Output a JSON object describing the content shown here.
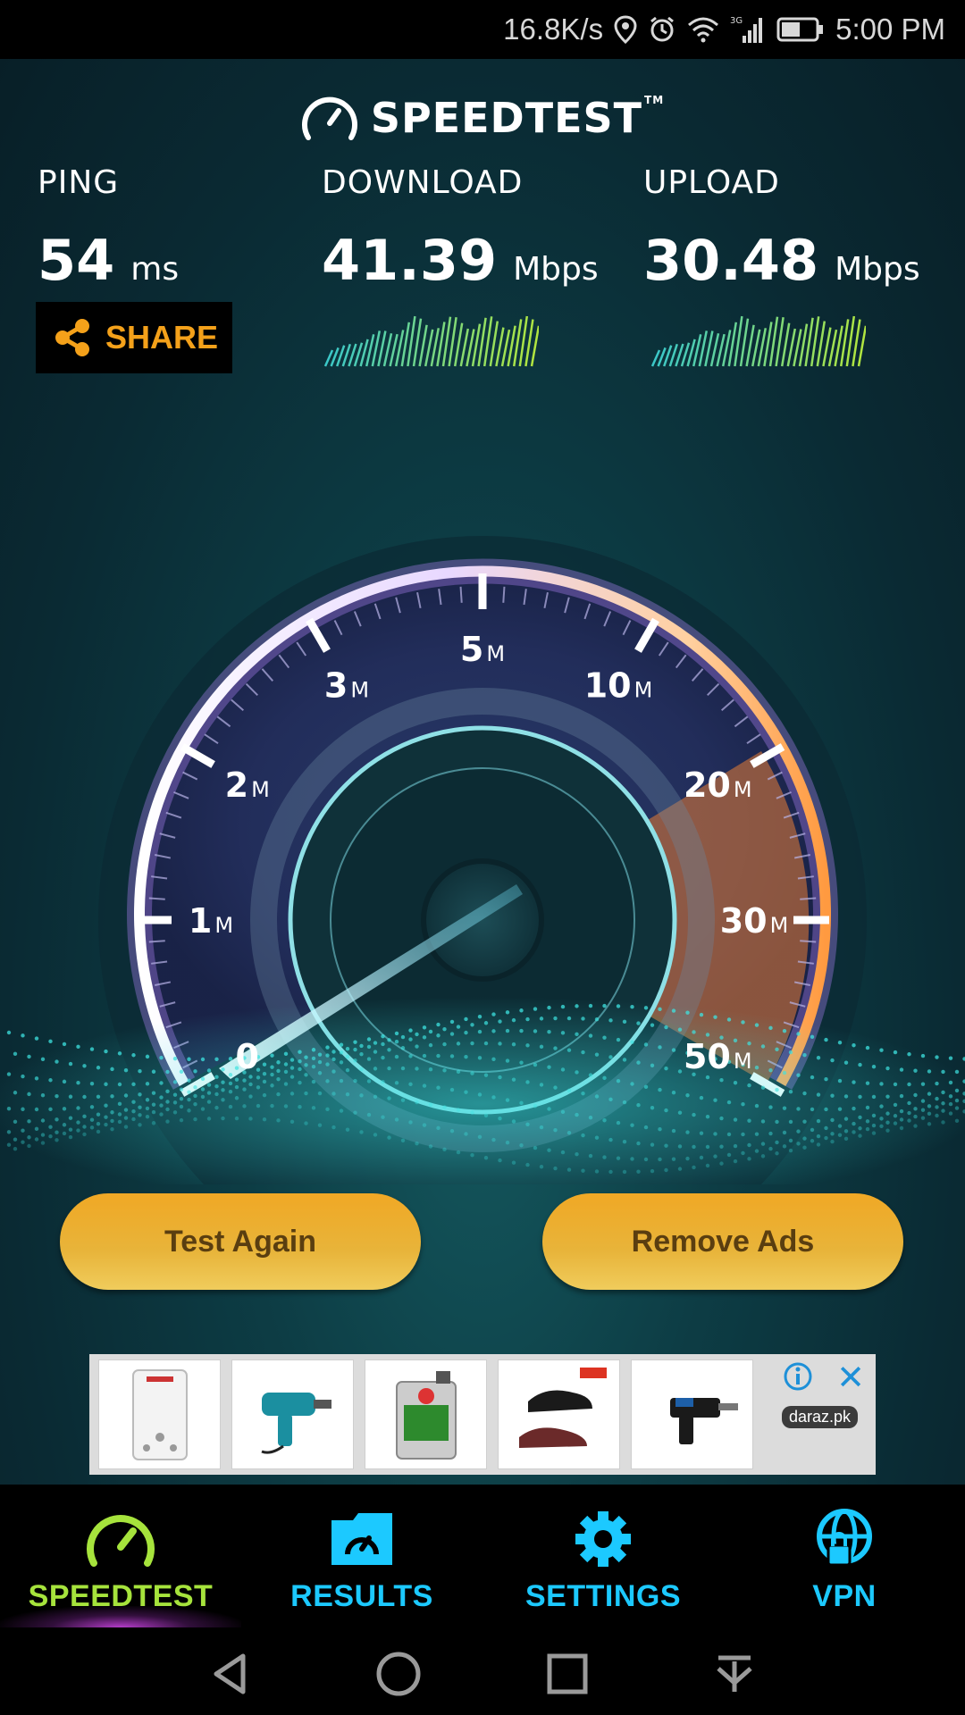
{
  "status_bar": {
    "speed": "16.8K/s",
    "network": "3G",
    "time": "5:00 PM",
    "icons": [
      "location-icon",
      "alarm-icon",
      "wifi-icon",
      "signal-icon",
      "battery-icon"
    ]
  },
  "header": {
    "logo_text": "SPEEDTEST",
    "trademark": "TM"
  },
  "metrics": {
    "ping": {
      "label": "PING",
      "value": "54",
      "unit": "ms"
    },
    "download": {
      "label": "DOWNLOAD",
      "value": "41.39",
      "unit": "Mbps"
    },
    "upload": {
      "label": "UPLOAD",
      "value": "30.48",
      "unit": "Mbps"
    }
  },
  "share": {
    "label": "SHARE"
  },
  "gauge": {
    "ticks": [
      "0",
      "1M",
      "2M",
      "3M",
      "5M",
      "10M",
      "20M",
      "30M",
      "50M"
    ],
    "needle_value": "0"
  },
  "buttons": {
    "test_again": "Test Again",
    "remove_ads": "Remove Ads"
  },
  "ad": {
    "brand": "daraz.pk",
    "items": [
      "water-heater",
      "power-drill",
      "motor-oil",
      "shoes",
      "rotary-hammer"
    ]
  },
  "tabs": [
    {
      "label": "SPEEDTEST",
      "icon": "speedometer-icon",
      "active": true
    },
    {
      "label": "RESULTS",
      "icon": "results-folder-icon",
      "active": false
    },
    {
      "label": "SETTINGS",
      "icon": "gear-icon",
      "active": false
    },
    {
      "label": "VPN",
      "icon": "vpn-globe-lock-icon",
      "active": false
    }
  ],
  "colors": {
    "accent_green": "#a6e33c",
    "accent_cyan": "#1cc9ff",
    "share_orange": "#f4a11a",
    "button_gold": "#e8b43a"
  }
}
